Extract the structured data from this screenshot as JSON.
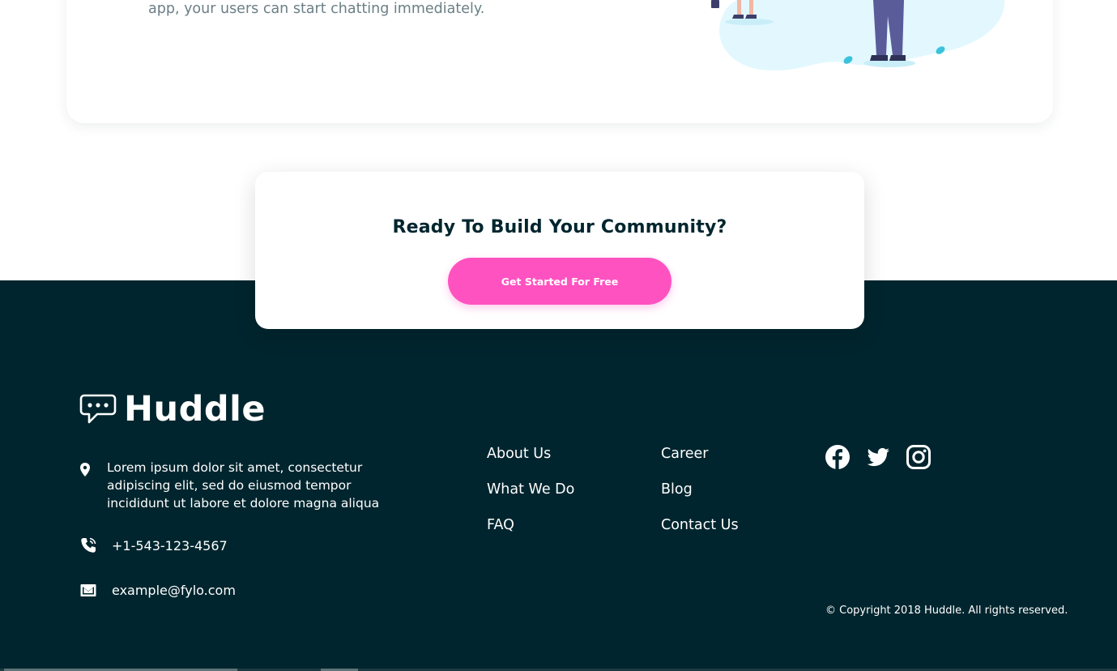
{
  "feature": {
    "text_tail": "app, your users can start chatting immediately."
  },
  "cta": {
    "title": "Ready To Build Your Community?",
    "button_label": "Get Started For Free"
  },
  "brand": {
    "name": "Huddle",
    "accent": "#ff52c1",
    "footer_bg": "#00252e"
  },
  "contact": {
    "address": "Lorem ipsum dolor sit amet, consectetur adipiscing elit, sed do eiusmod tempor incididunt ut labore et dolore magna aliqua",
    "phone": "+1-543-123-4567",
    "email": "example@fylo.com"
  },
  "links": {
    "col1": [
      "About Us",
      "What We Do",
      "FAQ"
    ],
    "col2": [
      "Career",
      "Blog",
      "Contact Us"
    ]
  },
  "social": [
    "facebook-icon",
    "twitter-icon",
    "instagram-icon"
  ],
  "copyright": "© Copyright 2018 Huddle. All rights reserved."
}
